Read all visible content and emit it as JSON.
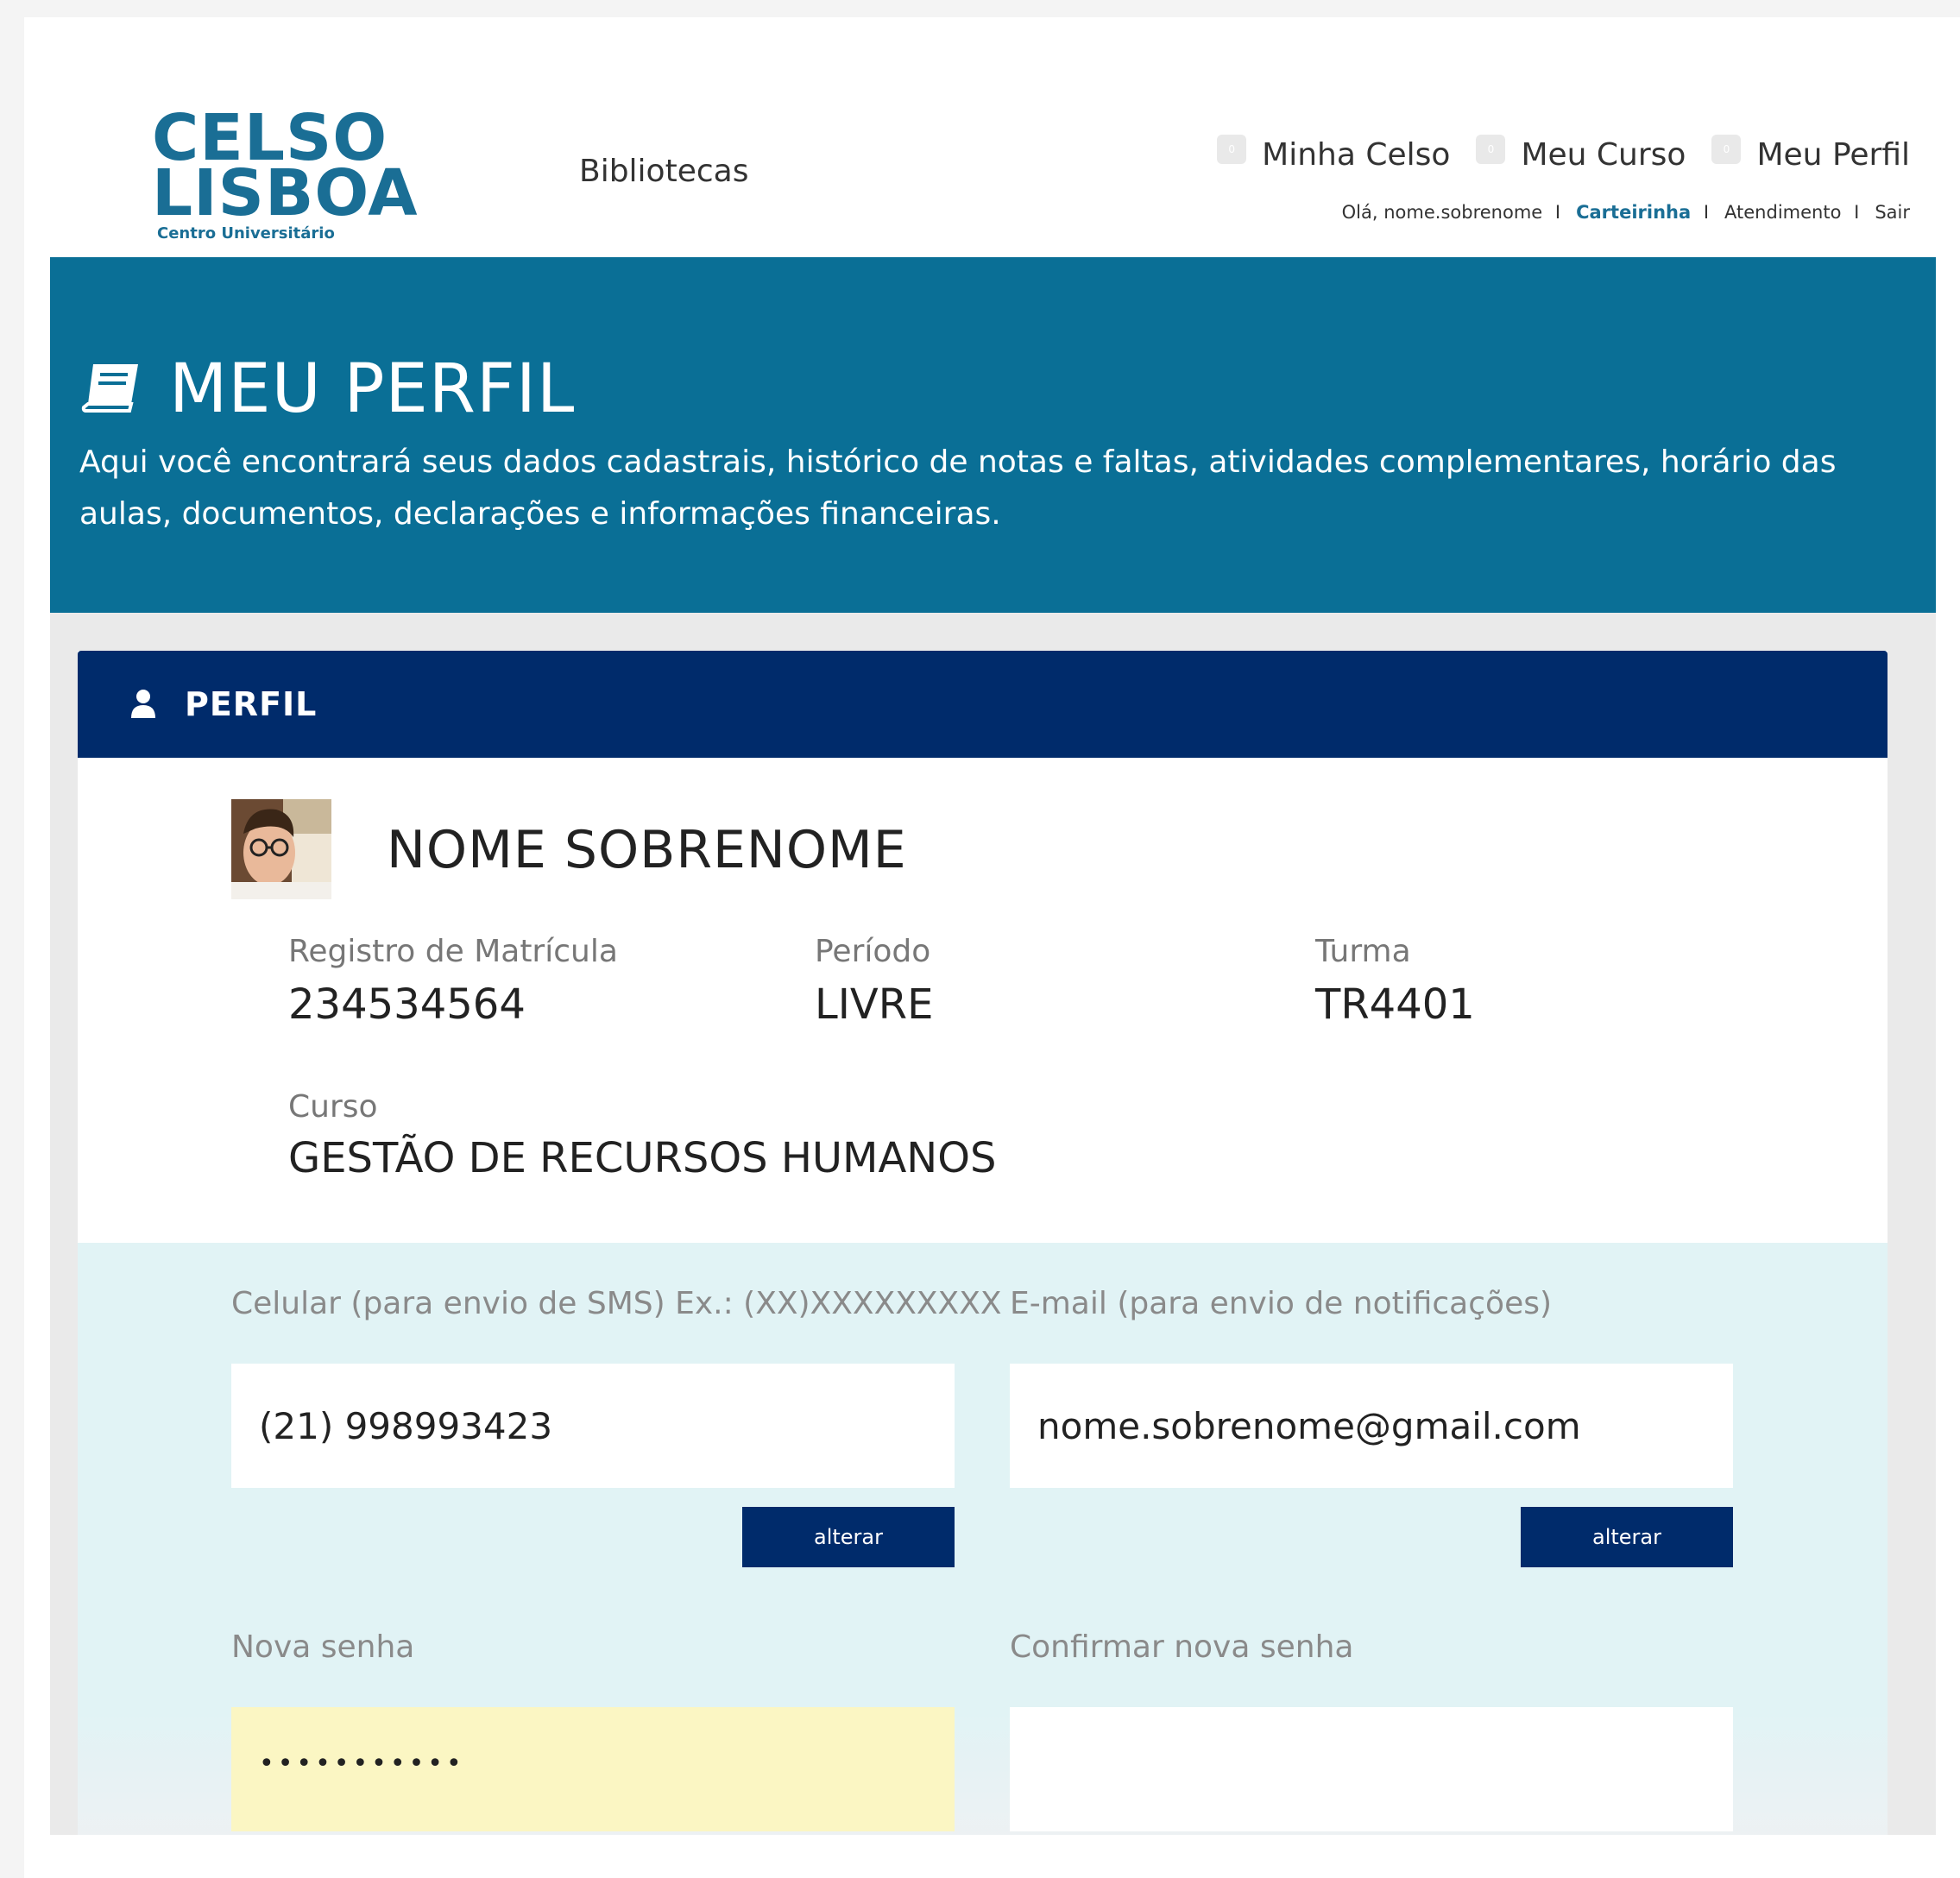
{
  "header": {
    "logo": {
      "line1": "CELSO",
      "line2": "LISBOA",
      "line3": "Centro Universitário"
    },
    "bibliotecas": "Bibliotecas",
    "nav": [
      {
        "badge": "0",
        "label": "Minha Celso"
      },
      {
        "badge": "0",
        "label": "Meu Curso"
      },
      {
        "badge": "0",
        "label": "Meu Perfil"
      }
    ],
    "subnav": {
      "greeting": "Olá, nome.sobrenome",
      "carteirinha": "Carteirinha",
      "atendimento": "Atendimento",
      "sair": "Sair",
      "separator": "I"
    }
  },
  "hero": {
    "title": "MEU PERFIL",
    "description": "Aqui você encontrará seus dados cadastrais, histórico de notas e faltas, atividades complementares, horário das aulas, documentos, declarações e informações financeiras."
  },
  "profile": {
    "section_title": "PERFIL",
    "name": "NOME SOBRENOME",
    "registro_label": "Registro de Matrícula",
    "registro_value": "234534564",
    "periodo_label": "Período",
    "periodo_value": "LIVRE",
    "turma_label": "Turma",
    "turma_value": "TR4401",
    "curso_label": "Curso",
    "curso_value": "GESTÃO DE RECURSOS HUMANOS"
  },
  "contact": {
    "celular_label": "Celular (para envio de SMS) Ex.: (XX)XXXXXXXXX",
    "celular_value": "(21) 998993423",
    "email_label": "E-mail (para envio de notificações)",
    "email_value": "nome.sobrenome@gmail.com",
    "alterar": "alterar",
    "nova_senha_label": "Nova senha",
    "nova_senha_mask": "•••••••••••",
    "confirmar_label": "Confirmar nova senha"
  },
  "colors": {
    "brand": "#1a6e95",
    "hero": "#0a6f96",
    "navy": "#002b6b",
    "contact_bg": "#e1f3f5",
    "autofill": "#fbf6c3"
  }
}
